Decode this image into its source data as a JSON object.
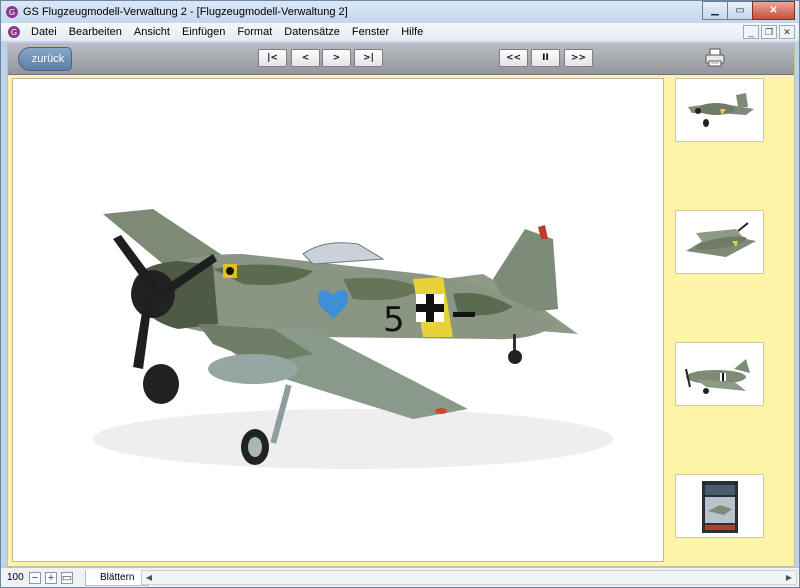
{
  "window": {
    "title": "GS Flugzeugmodell-Verwaltung 2 - [Flugzeugmodell-Verwaltung 2]"
  },
  "menu": {
    "items": [
      "Datei",
      "Bearbeiten",
      "Ansicht",
      "Einfügen",
      "Format",
      "Datensätze",
      "Fenster",
      "Hilfe"
    ]
  },
  "toolbar": {
    "back_label": "zurück",
    "nav": {
      "first": "|<",
      "prev": "<",
      "next": ">",
      "last": ">|",
      "rewind": "<<",
      "pause": "II",
      "forward": ">>"
    }
  },
  "main_image": {
    "subject": "airplane-model-photo",
    "number_label": "5"
  },
  "thumbnails": [
    {
      "subject": "airplane-front-view"
    },
    {
      "subject": "airplane-top-view"
    },
    {
      "subject": "airplane-side-view"
    },
    {
      "subject": "model-box-packaging"
    }
  ],
  "statusbar": {
    "zoom": "100",
    "mode_tab": "Blättern"
  },
  "colors": {
    "form_background": "#fef4a7",
    "toolbar": "#a3a7ac",
    "back_button": "#6f8fb6"
  }
}
